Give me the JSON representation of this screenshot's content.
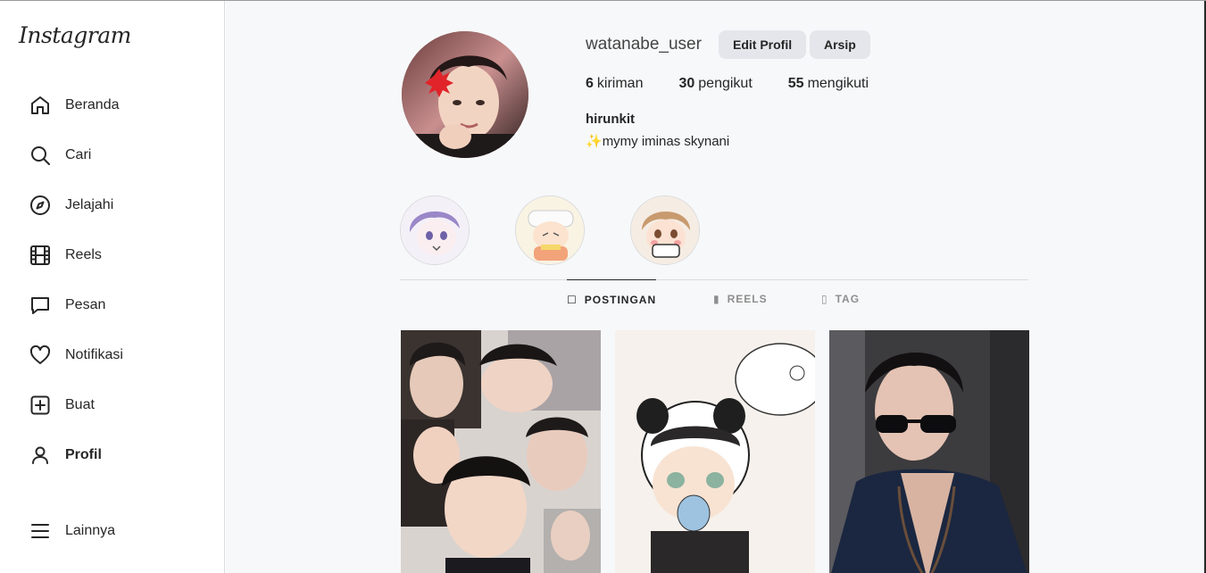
{
  "sidebar": {
    "logo": "Instagram",
    "items": [
      {
        "label": "Beranda",
        "icon": "home-icon"
      },
      {
        "label": "Cari",
        "icon": "search-icon"
      },
      {
        "label": "Jelajahi",
        "icon": "compass-icon"
      },
      {
        "label": "Reels",
        "icon": "reels-icon"
      },
      {
        "label": "Pesan",
        "icon": "message-icon"
      },
      {
        "label": "Notifikasi",
        "icon": "heart-icon"
      },
      {
        "label": "Buat",
        "icon": "plus-square-icon"
      },
      {
        "label": "Profil",
        "icon": "user-icon"
      },
      {
        "label": "Lainnya",
        "icon": "menu-icon"
      }
    ],
    "active": "Profil"
  },
  "profile": {
    "username": "watanabe_user",
    "edit_label": "Edit Profil",
    "archive_label": "Arsip",
    "posts_count": "6",
    "posts_label": "kiriman",
    "followers_count": "30",
    "followers_label": "pengikut",
    "following_count": "55",
    "following_label": "mengikuti",
    "full_name": "hirunkit",
    "bio": "mymy iminas skynani",
    "bio_emoji": "✨"
  },
  "tabs": {
    "posts": "POSTINGAN",
    "reels": "REELS",
    "tagged": "TAG"
  },
  "colors": {
    "background": "#f7f8fa",
    "button": "#e4e6eb",
    "text": "#262626",
    "muted": "#8e8e8e"
  }
}
